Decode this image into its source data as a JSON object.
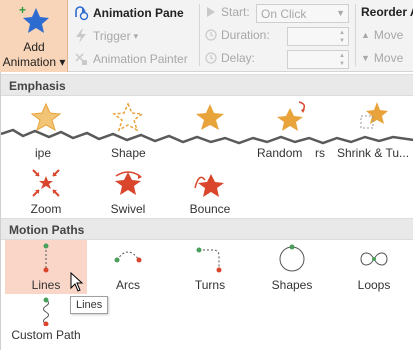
{
  "ribbon": {
    "add_animation": {
      "line1": "Add",
      "line2": "Animation",
      "arrow": "▾"
    },
    "animation_pane": "Animation Pane",
    "trigger": "Trigger",
    "trigger_arrow": "▾",
    "animation_painter": "Animation Painter",
    "start_label": "Start:",
    "start_value": "On Click",
    "duration_label": "Duration:",
    "delay_label": "Delay:",
    "reorder_label": "Reorder A",
    "move_earlier": "Move",
    "move_later": "Move"
  },
  "gallery": {
    "emphasis_header": "Emphasis",
    "emphasis_row1": [
      "ipe",
      "Shape",
      "",
      "Random",
      "rs",
      "Shrink & Tu..."
    ],
    "emphasis_row2": [
      "Zoom",
      "Swivel",
      "Bounce"
    ],
    "motion_header": "Motion Paths",
    "motion_row1": [
      "Lines",
      "Arcs",
      "Turns",
      "Shapes",
      "Loops"
    ],
    "motion_row2": [
      "Custom Path"
    ],
    "tooltip": "Lines"
  },
  "colors": {
    "accent": "#f8d5b8",
    "selected": "#f9d6c7",
    "star_blue": "#2e6bd0",
    "emphasis_gold": "#e8a33a",
    "entrance_red": "#d9462c",
    "path_red": "#d9462c",
    "path_green": "#4aa05a"
  },
  "icons": [
    "star-icon",
    "animation-pane-icon",
    "lightning-icon",
    "painter-icon",
    "clock-icon",
    "combo-arrow-icon",
    "spinner-icon"
  ]
}
